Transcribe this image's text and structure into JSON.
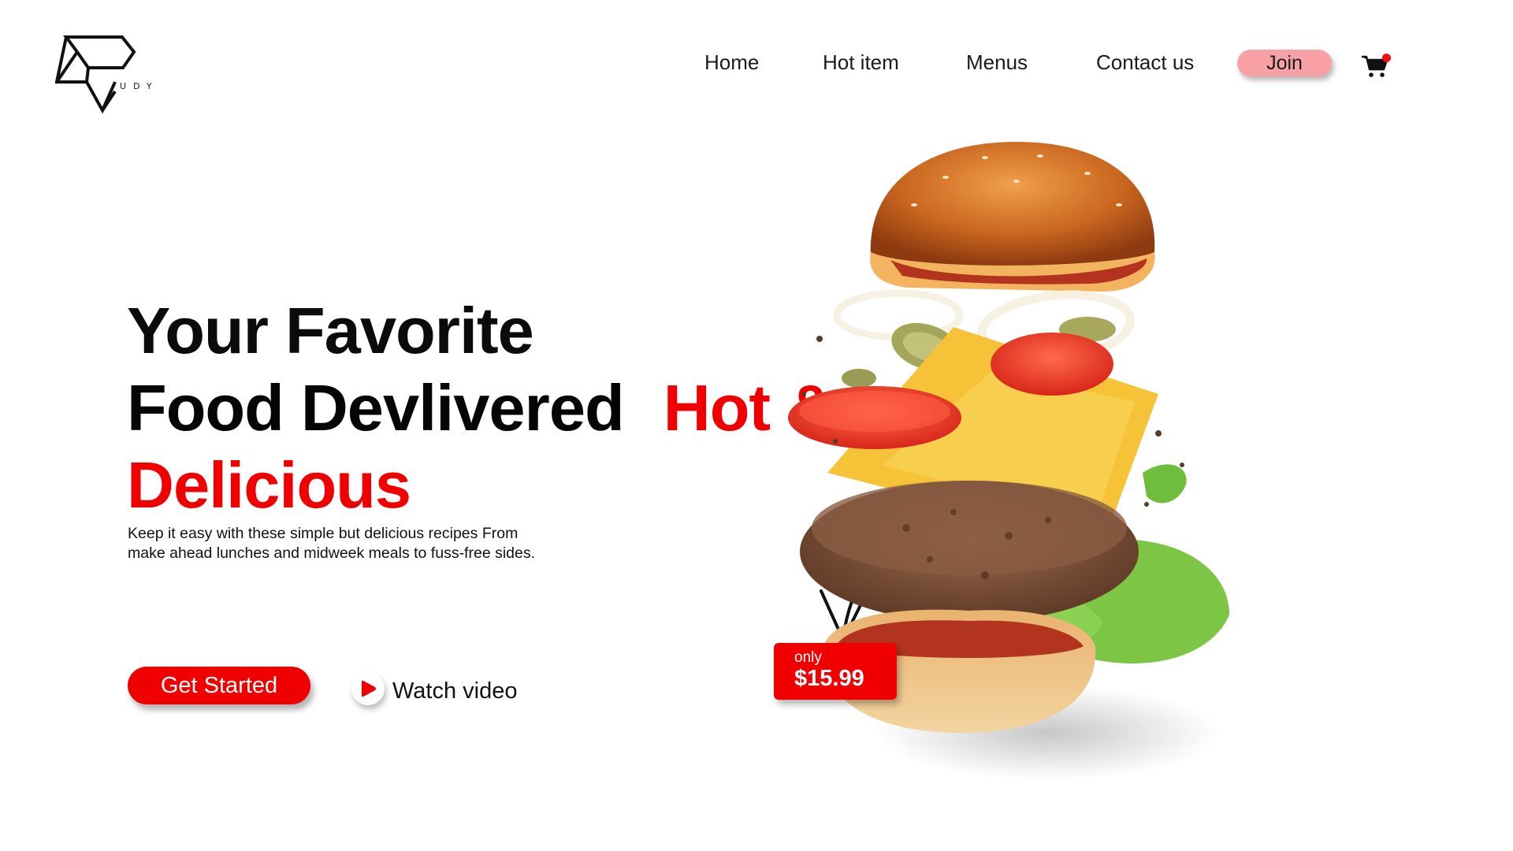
{
  "brand": {
    "logo_text": "UDY"
  },
  "nav": {
    "items": [
      {
        "label": "Home"
      },
      {
        "label": "Hot item"
      },
      {
        "label": "Menus"
      },
      {
        "label": "Contact us"
      }
    ],
    "join_label": "Join",
    "cart_icon": "cart-icon"
  },
  "hero": {
    "line1": "Your Favorite",
    "line2_black": "Food Devlivered",
    "line2_red": "Hot &",
    "line3": "Delicious",
    "description": "Keep it easy with these simple but delicious recipes From make ahead lunches and midweek meals to fuss-free sides.",
    "cta_label": "Get Started",
    "watch_label": "Watch video",
    "accent_color": "#f00000"
  },
  "price_tag": {
    "prefix": "only",
    "price": "$15.99"
  },
  "image": {
    "subject": "burger-image",
    "arrow": "curly-arrow"
  }
}
